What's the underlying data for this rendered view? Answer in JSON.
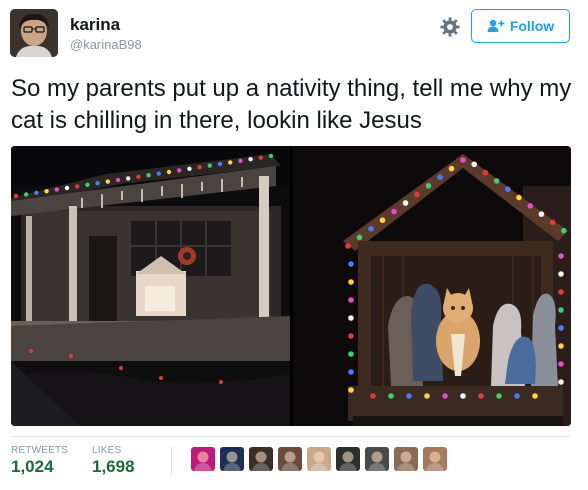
{
  "user": {
    "name": "karina",
    "handle": "@karinaB98"
  },
  "actions": {
    "follow_label": "Follow",
    "settings_icon": "gear-icon",
    "follow_icon": "add-user-icon"
  },
  "tweet": {
    "text": "So my parents put up a nativity thing, tell me why my cat is chilling in there, lookin like Jesus"
  },
  "stats": {
    "retweets_label": "RETWEETS",
    "retweets_value": "1,024",
    "likes_label": "LIKES",
    "likes_value": "1,698"
  },
  "likers": [
    {
      "color": "#c2187a"
    },
    {
      "color": "#1c2f55"
    },
    {
      "color": "#3a2d2a"
    },
    {
      "color": "#6b4b3e"
    },
    {
      "color": "#c9a98a"
    },
    {
      "color": "#2f2f2f"
    },
    {
      "color": "#4a4a4a"
    },
    {
      "color": "#8a6b53"
    },
    {
      "color": "#a77a5e"
    }
  ],
  "colors": {
    "accent": "#1da1f2",
    "stat_value": "#1b6b3a",
    "secondary_text": "#8899a6"
  }
}
